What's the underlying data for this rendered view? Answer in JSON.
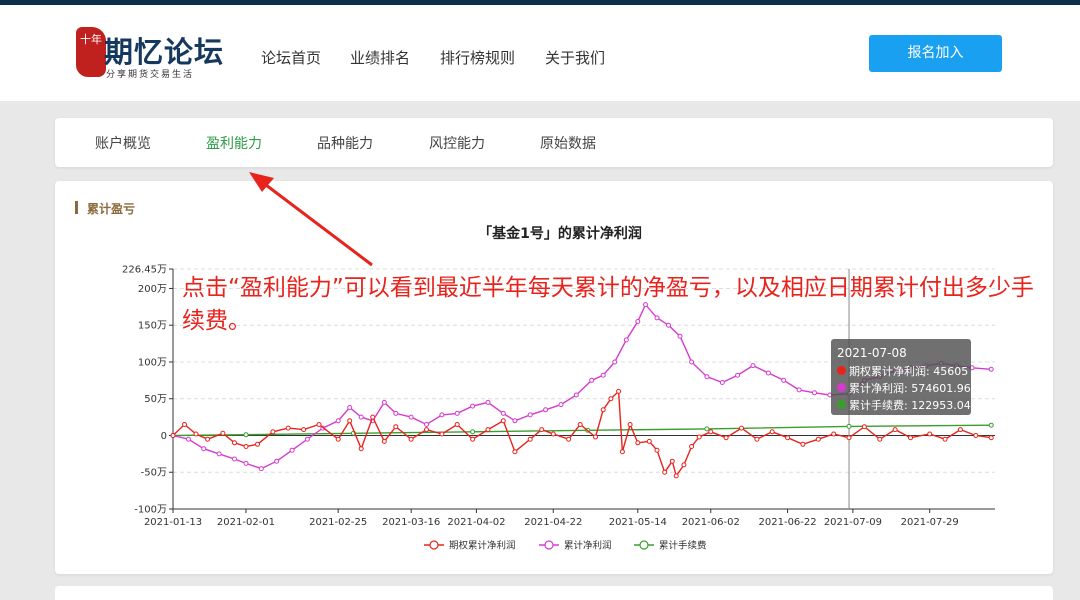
{
  "header": {
    "logo": {
      "badge": "十年",
      "name": "期忆论坛",
      "tagline": "分享期货交易生活"
    },
    "nav": [
      {
        "label": "论坛首页"
      },
      {
        "label": "业绩排名"
      },
      {
        "label": "排行榜规则"
      },
      {
        "label": "关于我们"
      }
    ],
    "join_label": "报名加入"
  },
  "tabs": [
    {
      "label": "账户概览",
      "active": false
    },
    {
      "label": "盈利能力",
      "active": true
    },
    {
      "label": "品种能力",
      "active": false
    },
    {
      "label": "风控能力",
      "active": false
    },
    {
      "label": "原始数据",
      "active": false
    }
  ],
  "section": {
    "title": "累计盈亏"
  },
  "annotation": {
    "text": "点击“盈利能力”可以看到最近半年每天累计的净盈亏，以及相应日期累计付出多少手续费。"
  },
  "tooltip": {
    "date": "2021-07-08",
    "rows": [
      {
        "label": "期权累计净利润: 45605",
        "color": "#e8231c"
      },
      {
        "label": "累计净利润: 574601.96",
        "color": "#d63bd0"
      },
      {
        "label": "累计手续费: 122953.04",
        "color": "#3a9e2e"
      }
    ]
  },
  "colors": {
    "accent": "#2e9c48",
    "button": "#1aa0f0",
    "annotation": "#e8231c"
  },
  "chart_data": {
    "type": "line",
    "title": "「基金1号」的累计净利润",
    "xlabel": "",
    "ylabel": "",
    "ylim": [
      -100,
      226.45
    ],
    "y_ticks": [
      {
        "value": -100,
        "label": "-100万"
      },
      {
        "value": -50,
        "label": "-50万"
      },
      {
        "value": 0,
        "label": "0"
      },
      {
        "value": 50,
        "label": "50万"
      },
      {
        "value": 100,
        "label": "100万"
      },
      {
        "value": 150,
        "label": "150万"
      },
      {
        "value": 200,
        "label": "200万"
      },
      {
        "value": 226.45,
        "label": "226.45万"
      }
    ],
    "x_range": [
      "2021-01-13",
      "2021-08-15"
    ],
    "x_ticks": [
      "2021-01-13",
      "2021-02-01",
      "2021-02-25",
      "2021-03-16",
      "2021-04-02",
      "2021-04-22",
      "2021-05-14",
      "2021-06-02",
      "2021-06-22",
      "2021-07-09",
      "2021-07-29"
    ],
    "grid": true,
    "legend_position": "bottom",
    "crosshair_x": "2021-07-08",
    "series": [
      {
        "name": "期权累计净利润",
        "color": "#e8231c",
        "points": [
          [
            "2021-01-13",
            0
          ],
          [
            "2021-01-16",
            15
          ],
          [
            "2021-01-19",
            2
          ],
          [
            "2021-01-22",
            -5
          ],
          [
            "2021-01-26",
            3
          ],
          [
            "2021-01-29",
            -10
          ],
          [
            "2021-02-01",
            -15
          ],
          [
            "2021-02-04",
            -12
          ],
          [
            "2021-02-08",
            5
          ],
          [
            "2021-02-12",
            10
          ],
          [
            "2021-02-16",
            8
          ],
          [
            "2021-02-20",
            15
          ],
          [
            "2021-02-25",
            -5
          ],
          [
            "2021-02-28",
            20
          ],
          [
            "2021-03-03",
            -18
          ],
          [
            "2021-03-06",
            25
          ],
          [
            "2021-03-09",
            -8
          ],
          [
            "2021-03-12",
            12
          ],
          [
            "2021-03-16",
            -5
          ],
          [
            "2021-03-20",
            8
          ],
          [
            "2021-03-24",
            2
          ],
          [
            "2021-03-28",
            15
          ],
          [
            "2021-04-01",
            -5
          ],
          [
            "2021-04-05",
            8
          ],
          [
            "2021-04-09",
            20
          ],
          [
            "2021-04-12",
            -22
          ],
          [
            "2021-04-16",
            -5
          ],
          [
            "2021-04-19",
            8
          ],
          [
            "2021-04-22",
            2
          ],
          [
            "2021-04-26",
            -5
          ],
          [
            "2021-04-29",
            15
          ],
          [
            "2021-05-03",
            -2
          ],
          [
            "2021-05-05",
            35
          ],
          [
            "2021-05-07",
            50
          ],
          [
            "2021-05-09",
            60
          ],
          [
            "2021-05-10",
            -22
          ],
          [
            "2021-05-12",
            15
          ],
          [
            "2021-05-14",
            -10
          ],
          [
            "2021-05-17",
            -8
          ],
          [
            "2021-05-19",
            -20
          ],
          [
            "2021-05-21",
            -50
          ],
          [
            "2021-05-23",
            -35
          ],
          [
            "2021-05-24",
            -55
          ],
          [
            "2021-05-26",
            -40
          ],
          [
            "2021-05-28",
            -15
          ],
          [
            "2021-05-30",
            -2
          ],
          [
            "2021-06-02",
            5
          ],
          [
            "2021-06-06",
            -3
          ],
          [
            "2021-06-10",
            10
          ],
          [
            "2021-06-14",
            -5
          ],
          [
            "2021-06-18",
            5
          ],
          [
            "2021-06-22",
            -3
          ],
          [
            "2021-06-26",
            -12
          ],
          [
            "2021-06-30",
            -5
          ],
          [
            "2021-07-04",
            2
          ],
          [
            "2021-07-08",
            -3
          ],
          [
            "2021-07-12",
            12
          ],
          [
            "2021-07-16",
            -5
          ],
          [
            "2021-07-20",
            8
          ],
          [
            "2021-07-24",
            -3
          ],
          [
            "2021-07-29",
            2
          ],
          [
            "2021-08-02",
            -5
          ],
          [
            "2021-08-06",
            8
          ],
          [
            "2021-08-10",
            0
          ],
          [
            "2021-08-14",
            -3
          ]
        ]
      },
      {
        "name": "累计净利润",
        "color": "#d63bd0",
        "points": [
          [
            "2021-01-13",
            0
          ],
          [
            "2021-01-17",
            -5
          ],
          [
            "2021-01-21",
            -18
          ],
          [
            "2021-01-25",
            -25
          ],
          [
            "2021-01-29",
            -32
          ],
          [
            "2021-02-01",
            -38
          ],
          [
            "2021-02-05",
            -45
          ],
          [
            "2021-02-09",
            -35
          ],
          [
            "2021-02-13",
            -20
          ],
          [
            "2021-02-17",
            -5
          ],
          [
            "2021-02-21",
            10
          ],
          [
            "2021-02-25",
            20
          ],
          [
            "2021-02-28",
            38
          ],
          [
            "2021-03-03",
            25
          ],
          [
            "2021-03-06",
            20
          ],
          [
            "2021-03-09",
            45
          ],
          [
            "2021-03-12",
            30
          ],
          [
            "2021-03-16",
            25
          ],
          [
            "2021-03-20",
            15
          ],
          [
            "2021-03-24",
            28
          ],
          [
            "2021-03-28",
            30
          ],
          [
            "2021-04-01",
            40
          ],
          [
            "2021-04-05",
            45
          ],
          [
            "2021-04-09",
            30
          ],
          [
            "2021-04-12",
            20
          ],
          [
            "2021-04-16",
            28
          ],
          [
            "2021-04-20",
            35
          ],
          [
            "2021-04-24",
            42
          ],
          [
            "2021-04-28",
            55
          ],
          [
            "2021-05-02",
            75
          ],
          [
            "2021-05-05",
            82
          ],
          [
            "2021-05-08",
            100
          ],
          [
            "2021-05-11",
            130
          ],
          [
            "2021-05-14",
            155
          ],
          [
            "2021-05-16",
            178
          ],
          [
            "2021-05-19",
            160
          ],
          [
            "2021-05-22",
            150
          ],
          [
            "2021-05-25",
            135
          ],
          [
            "2021-05-28",
            100
          ],
          [
            "2021-06-01",
            80
          ],
          [
            "2021-06-05",
            72
          ],
          [
            "2021-06-09",
            82
          ],
          [
            "2021-06-13",
            95
          ],
          [
            "2021-06-17",
            85
          ],
          [
            "2021-06-21",
            75
          ],
          [
            "2021-06-25",
            62
          ],
          [
            "2021-06-29",
            58
          ],
          [
            "2021-07-03",
            55
          ],
          [
            "2021-07-08",
            57
          ],
          [
            "2021-07-12",
            75
          ],
          [
            "2021-07-16",
            80
          ],
          [
            "2021-07-20",
            88
          ],
          [
            "2021-07-24",
            92
          ],
          [
            "2021-07-28",
            95
          ],
          [
            "2021-08-01",
            98
          ],
          [
            "2021-08-05",
            95
          ],
          [
            "2021-08-09",
            92
          ],
          [
            "2021-08-14",
            90
          ]
        ]
      },
      {
        "name": "累计手续费",
        "color": "#3a9e2e",
        "points": [
          [
            "2021-01-13",
            0
          ],
          [
            "2021-02-01",
            1
          ],
          [
            "2021-03-01",
            3
          ],
          [
            "2021-04-01",
            5
          ],
          [
            "2021-05-01",
            7
          ],
          [
            "2021-06-01",
            9
          ],
          [
            "2021-07-08",
            12.3
          ],
          [
            "2021-08-14",
            14
          ]
        ]
      }
    ]
  }
}
